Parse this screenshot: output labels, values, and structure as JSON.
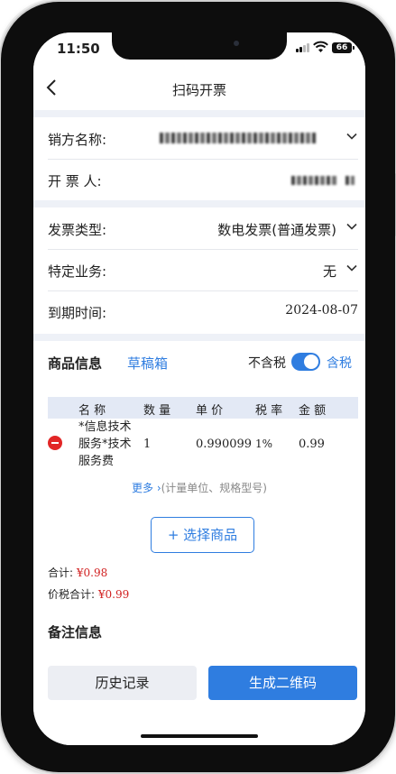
{
  "status_bar": {
    "time": "11:50",
    "battery": "66"
  },
  "nav": {
    "title": "扫码开票"
  },
  "seller": {
    "name_label": "销方名称:",
    "issuer_label": "开 票 人:"
  },
  "invoice": {
    "type_label": "发票类型:",
    "type_value": "数电发票(普通发票)",
    "business_label": "特定业务:",
    "business_value": "无",
    "due_label": "到期时间:",
    "due_value": "2024-08-07"
  },
  "goods": {
    "title": "商品信息",
    "draft_label": "草稿箱",
    "tax_exclusive": "不含税",
    "tax_inclusive": "含税",
    "headers": [
      "名 称",
      "数 量",
      "单 价",
      "税 率",
      "金 额"
    ],
    "rows": [
      {
        "name_lines": [
          "*信息技术",
          "服务*技术",
          "服务费"
        ],
        "qty": "1",
        "price": "0.990099",
        "rate": "1%",
        "amount": "0.99"
      }
    ],
    "more_link": "更多",
    "more_hint": "(计量单位、规格型号)",
    "select_button": "+ 选择商品",
    "total_label": "合计:",
    "total_value": "¥0.98",
    "tax_total_label": "价税合计:",
    "tax_total_value": "¥0.99"
  },
  "remark": {
    "title": "备注信息"
  },
  "actions": {
    "history": "历史记录",
    "generate_qr": "生成二维码"
  }
}
